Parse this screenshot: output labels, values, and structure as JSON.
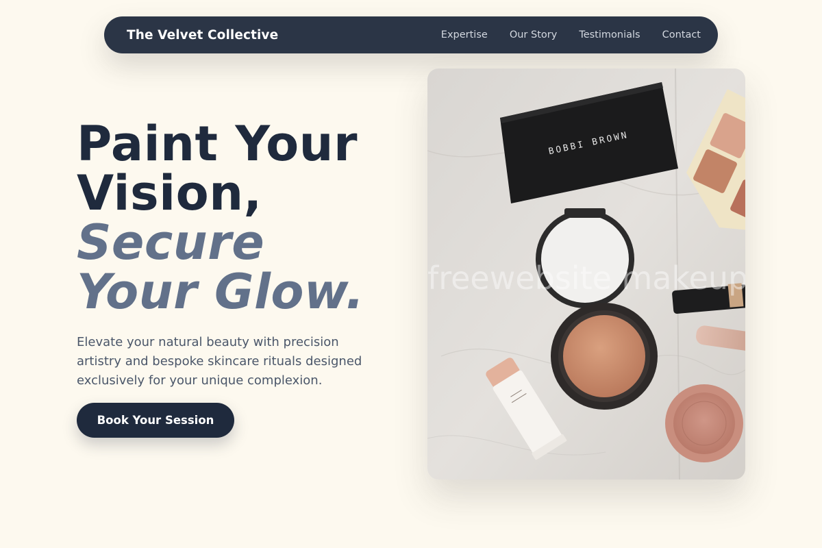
{
  "nav": {
    "brand": "The Velvet Collective",
    "links": [
      "Expertise",
      "Our Story",
      "Testimonials",
      "Contact"
    ]
  },
  "hero": {
    "title_line1": "Paint Your",
    "title_line2": "Vision,",
    "title_line3": "Secure",
    "title_line4": "Your Glow.",
    "subtitle": "Elevate your natural beauty with precision artistry and bespoke skincare rituals designed exclusively for your unique complexion.",
    "cta_label": "Book Your Session"
  },
  "photo": {
    "brand_text": "BOBBI BROWN",
    "watermark": "freewebsite makeup"
  },
  "colors": {
    "background": "#fdf9ef",
    "navbar": "#2b3546",
    "primary": "#1f2a3d",
    "accent": "#62718a"
  }
}
